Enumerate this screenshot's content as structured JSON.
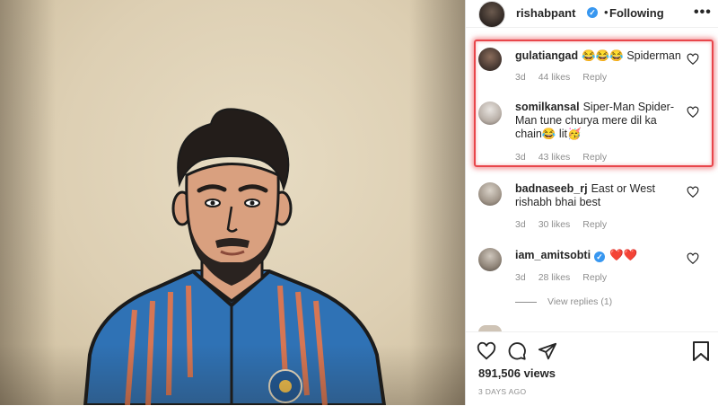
{
  "post": {
    "username": "rishabpant",
    "separator": "•",
    "following_label": "Following",
    "more_label": "•••"
  },
  "comments": [
    {
      "user": "gulatiangad",
      "text": "😂😂😂 Spiderman",
      "age": "3d",
      "likes": "44 likes",
      "reply": "Reply"
    },
    {
      "user": "somilkansal",
      "text": "Siper-Man Spider-Man tune churya mere dil ka chain😂 lit🥳",
      "age": "3d",
      "likes": "43 likes",
      "reply": "Reply"
    },
    {
      "user": "badnaseeb_rj",
      "text": "East or West rishabh bhai best",
      "age": "3d",
      "likes": "30 likes",
      "reply": "Reply"
    },
    {
      "user": "iam_amitsobti",
      "text": "❤️❤️",
      "age": "3d",
      "likes": "28 likes",
      "reply": "Reply"
    }
  ],
  "view_replies": "View replies (1)",
  "actions": {
    "like": "heart-icon",
    "comment": "comment-icon",
    "share": "share-icon",
    "save": "bookmark-icon"
  },
  "views": "891,506 views",
  "date": "3 DAYS AGO",
  "colors": {
    "verified": "#3897f0",
    "highlight": "#e8464b",
    "muted_text": "#8e8e8e"
  }
}
